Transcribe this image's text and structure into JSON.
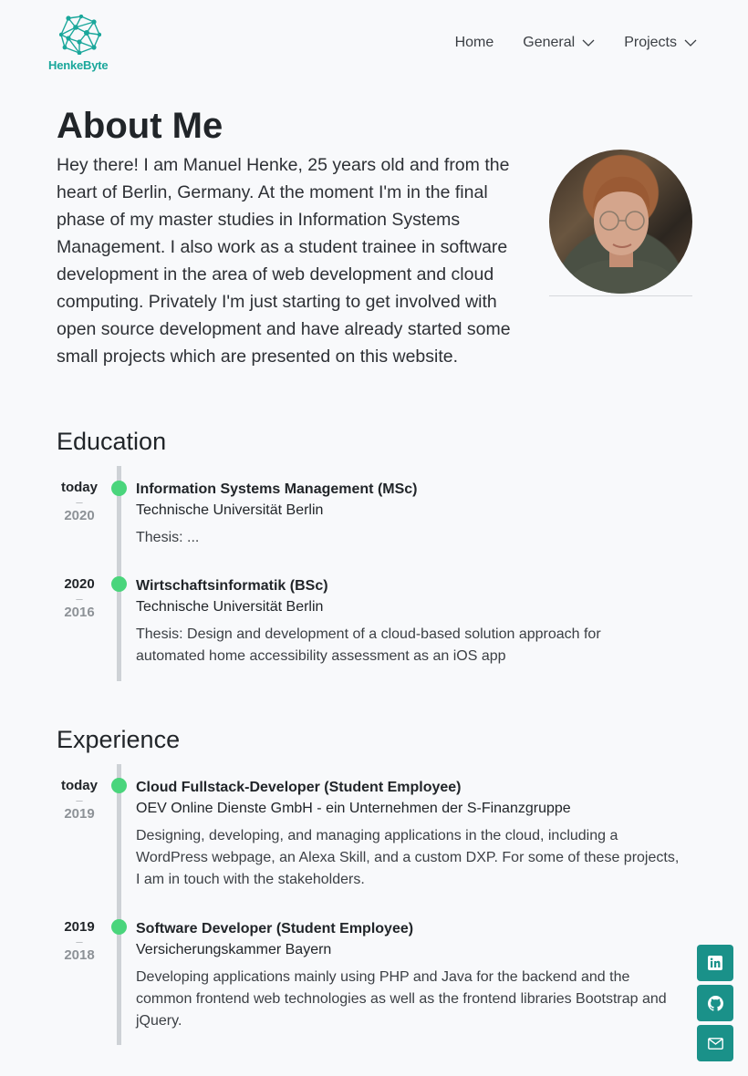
{
  "brand": {
    "name": "HenkeByte",
    "accent": "#1aa79b"
  },
  "nav": {
    "items": [
      {
        "label": "Home"
      },
      {
        "label": "General"
      },
      {
        "label": "Projects"
      }
    ]
  },
  "about": {
    "title": "About Me",
    "text": "Hey there! I am Manuel Henke, 25 years old and from the heart of Berlin, Germany. At the moment I'm in the final phase of my master studies in Information Systems Management. I also work as a student trainee in software development in the area of web development and cloud computing. Privately I'm just starting to get involved with open source development and have already started some small projects which are presented on this website."
  },
  "education": {
    "title": "Education",
    "entries": [
      {
        "year_to": "today",
        "dash": "–",
        "year_from": "2020",
        "title": "Information Systems Management (MSc)",
        "org": "Technische Universität Berlin",
        "desc": "Thesis: ..."
      },
      {
        "year_to": "2020",
        "dash": "–",
        "year_from": "2016",
        "title": "Wirtschaftsinformatik (BSc)",
        "org": "Technische Universität Berlin",
        "desc": "Thesis: Design and development of a cloud-based solution approach for automated home accessibility assessment as an iOS app"
      }
    ]
  },
  "experience": {
    "title": "Experience",
    "entries": [
      {
        "year_to": "today",
        "dash": "–",
        "year_from": "2019",
        "title": "Cloud Fullstack-Developer (Student Employee)",
        "org": "OEV Online Dienste GmbH - ein Unternehmen der S-Finanzgruppe",
        "desc": "Designing, developing, and managing applications in the cloud, including a WordPress webpage, an Alexa Skill, and a custom DXP. For some of these projects, I am in touch with the stakeholders."
      },
      {
        "year_to": "2019",
        "dash": "–",
        "year_from": "2018",
        "title": "Software Developer (Student Employee)",
        "org": "Versicherungskammer Bayern",
        "desc": "Developing applications mainly using PHP and Java for the backend and the common frontend web technologies as well as the frontend libraries Bootstrap and jQuery."
      }
    ]
  },
  "social": {
    "icons": [
      "linkedin-icon",
      "github-icon",
      "mail-icon"
    ],
    "color": "#1a9189"
  },
  "colors": {
    "timeline_dot": "#4ad57c",
    "timeline_line": "#ced2d6"
  }
}
